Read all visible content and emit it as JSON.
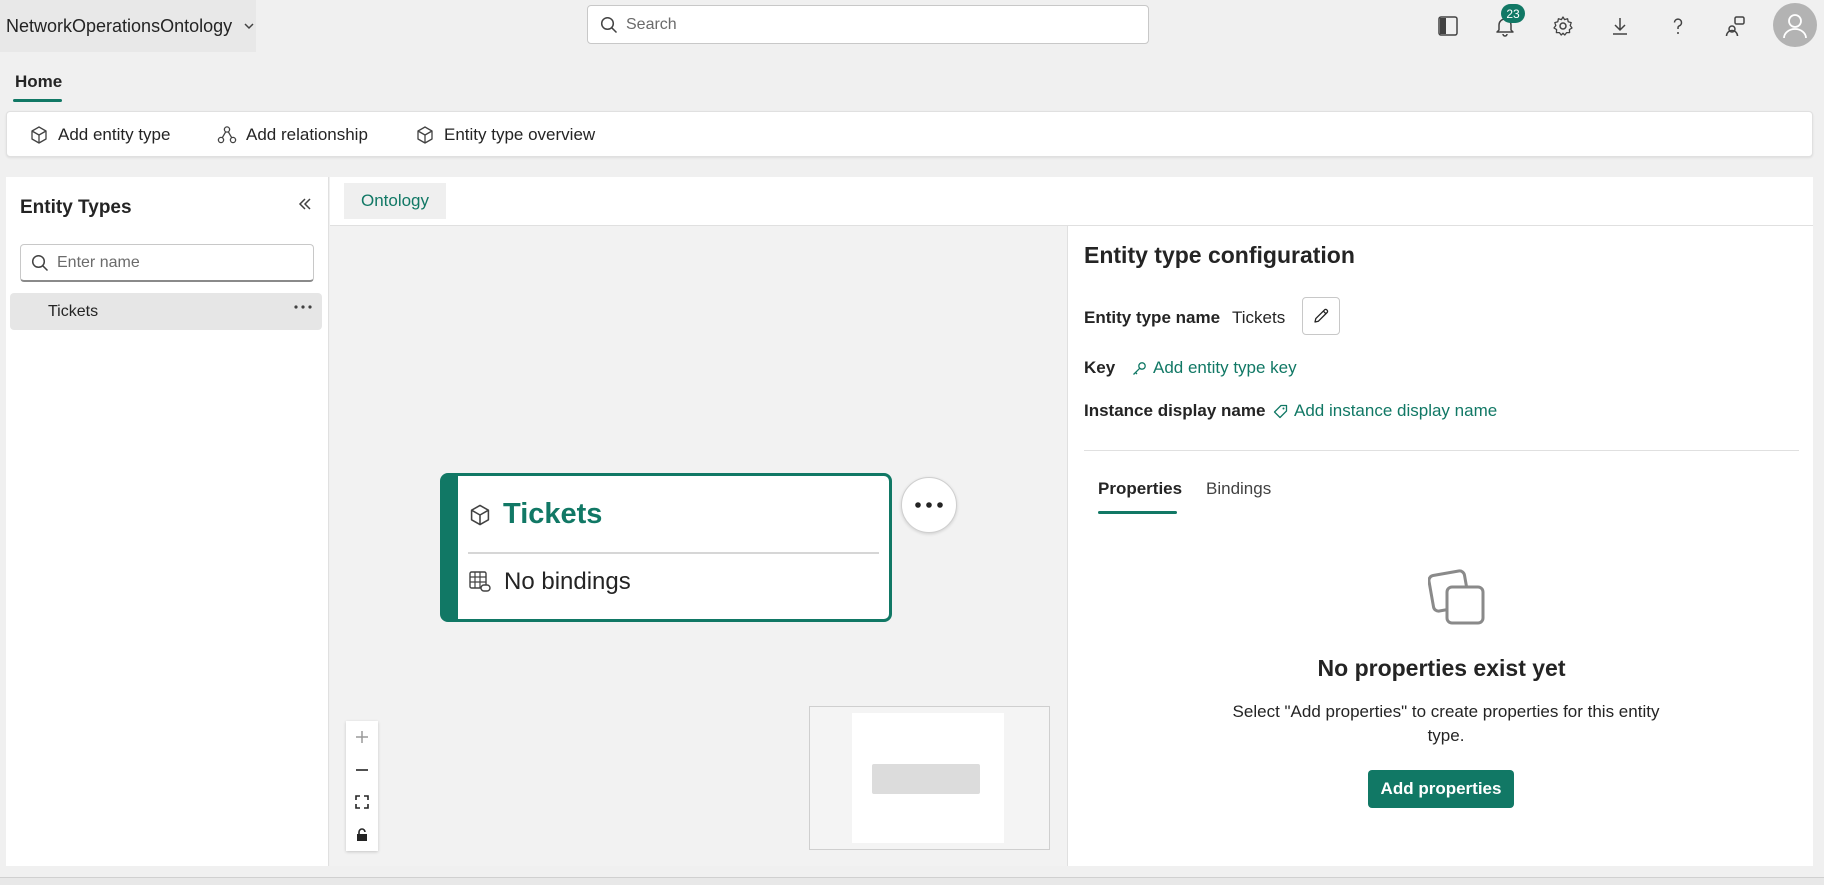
{
  "app": {
    "workspace_name": "NetworkOperationsOntology"
  },
  "search": {
    "placeholder": "Search"
  },
  "topbar": {
    "icons": [
      "panel-toggle-icon",
      "bell-icon",
      "gear-icon",
      "download-icon",
      "help-icon",
      "share-icon",
      "user-avatar-icon"
    ],
    "notification_count": "23"
  },
  "ribbon": {
    "tab_label": "Home",
    "buttons": {
      "add_entity_type": "Add entity type",
      "add_relationship": "Add relationship",
      "entity_type_overview": "Entity type overview"
    }
  },
  "left_panel": {
    "title": "Entity Types",
    "filter_placeholder": "Enter name",
    "items": [
      {
        "label": "Tickets"
      }
    ]
  },
  "main": {
    "tab_label": "Ontology"
  },
  "canvas": {
    "node": {
      "title": "Tickets",
      "binding_status": "No bindings"
    }
  },
  "config": {
    "title": "Entity type configuration",
    "name_label": "Entity type name",
    "name_value": "Tickets",
    "key_label": "Key",
    "key_link": "Add entity type key",
    "display_label": "Instance display name",
    "display_link": "Add instance display name",
    "tabs": {
      "properties": "Properties",
      "bindings": "Bindings"
    },
    "empty": {
      "title": "No properties exist yet",
      "description": "Select \"Add properties\" to create properties for this entity type.",
      "button": "Add properties"
    }
  },
  "colors": {
    "accent": "#117865",
    "background": "#f0f0f0"
  }
}
